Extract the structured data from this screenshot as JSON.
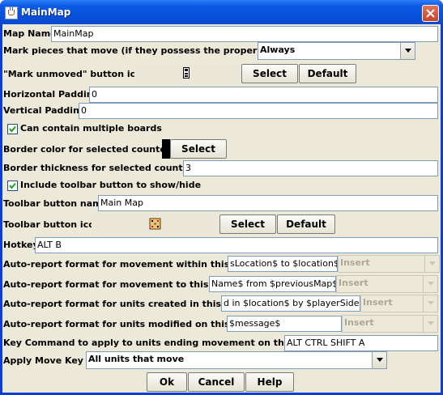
{
  "window": {
    "title": "MainMap"
  },
  "fields": {
    "map_name": {
      "label": "Map Name",
      "value": "MainMap"
    },
    "mark_pieces": {
      "label": "Mark pieces that move (if they possess the proper trait)",
      "value": "Always"
    },
    "mark_unmoved_icon": {
      "label": "\"Mark unmoved\" button icon",
      "select": "Select",
      "default": "Default"
    },
    "h_padding": {
      "label": "Horizontal Padding",
      "value": "0"
    },
    "v_padding": {
      "label": "Vertical Padding",
      "value": "0"
    },
    "multi_boards": {
      "label": "Can contain multiple boards",
      "checked": true
    },
    "border_color": {
      "label": "Border color for selected counters",
      "select": "Select",
      "color": "#000000"
    },
    "border_thickness": {
      "label": "Border thickness for selected counters",
      "value": "3"
    },
    "toolbar_button": {
      "label": "Include toolbar button to show/hide",
      "checked": true
    },
    "toolbar_name": {
      "label": "Toolbar button name",
      "value": "Main Map"
    },
    "toolbar_icon": {
      "label": "Toolbar button icon",
      "select": "Select",
      "default": "Default"
    },
    "hotkey": {
      "label": "Hotkey",
      "value": "ALT B"
    },
    "report_within": {
      "label": "Auto-report format for movement within this map",
      "value": "$pieceName$ moves $previousLocation$ to $location$",
      "shown": "sLocation$ to $location$",
      "insert": "Insert"
    },
    "report_to": {
      "label": "Auto-report format for movement to this map",
      "value": "$pieceName$ from $previousMap$",
      "shown": "Name$ from $previousMap$",
      "insert": "Insert"
    },
    "report_created": {
      "label": "Auto-report format for units created in this map",
      "value": "$pieceName$ created in $location$ by $playerSide$",
      "shown": "d in $location$ by $playerSide$",
      "insert": "Insert"
    },
    "report_modified": {
      "label": "Auto-report format for units modified on this map",
      "value": "$message$",
      "insert": "Insert"
    },
    "key_command": {
      "label": "Key Command to apply to units ending movement on this map",
      "value": "ALT CTRL SHIFT A"
    },
    "apply_move_key": {
      "label": "Apply Move Key to",
      "value": "All units that move"
    }
  },
  "buttons": {
    "ok": "Ok",
    "cancel": "Cancel",
    "help": "Help"
  },
  "icons": {
    "close": "close-icon",
    "app": "java-cup-icon",
    "unmoved_preview": "unmoved-marker-icon",
    "toolbar_preview": "dice-icon"
  }
}
